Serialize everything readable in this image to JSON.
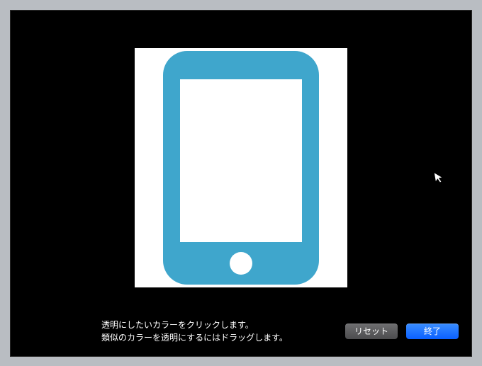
{
  "instructions": {
    "line1": "透明にしたいカラーをクリックします。",
    "line2": "類似のカラーを透明にするにはドラッグします。"
  },
  "buttons": {
    "reset": "リセット",
    "done": "終了"
  },
  "image": {
    "icon_name": "phone-icon",
    "icon_color": "#3fa6cc",
    "background": "#ffffff"
  }
}
